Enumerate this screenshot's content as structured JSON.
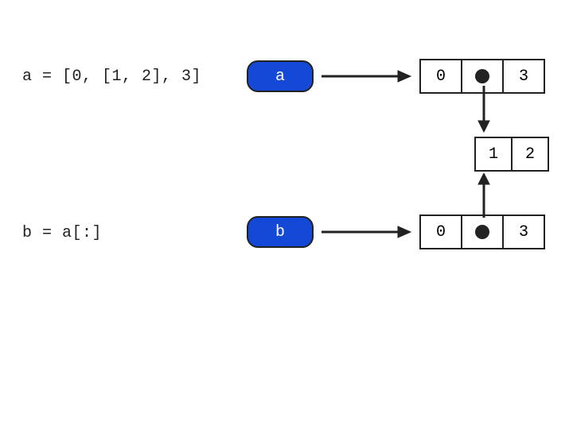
{
  "code_a": "a = [0, [1, 2], 3]",
  "code_b": "b = a[:]",
  "var_a": "a",
  "var_b": "b",
  "list_a": {
    "c0": "0",
    "c2": "3"
  },
  "list_b": {
    "c0": "0",
    "c2": "3"
  },
  "inner": {
    "c0": "1",
    "c1": "2"
  },
  "colors": {
    "pill": "#1449d8"
  }
}
